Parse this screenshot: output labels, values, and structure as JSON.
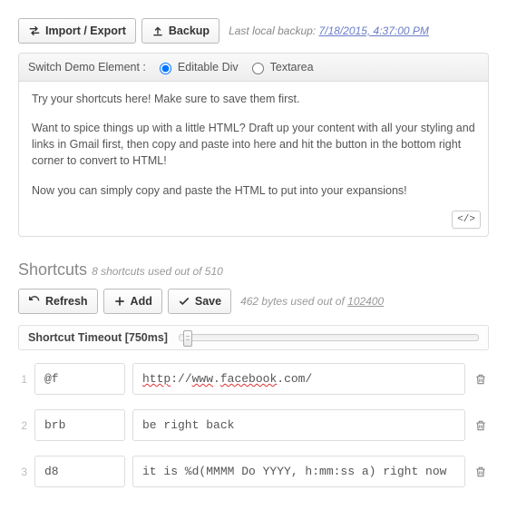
{
  "toolbar": {
    "import_export": "Import / Export",
    "backup": "Backup",
    "backup_prefix": "Last local backup:",
    "backup_time": "7/18/2015, 4:37:00 PM"
  },
  "demo": {
    "switch_label": "Switch Demo Element :",
    "opt_editable": "Editable Div",
    "opt_textarea": "Textarea",
    "p1": "Try your shortcuts here! Make sure to save them first.",
    "p2": "Want to spice things up with a little HTML? Draft up your content with all your styling and links in Gmail first, then copy and paste into here and hit the button in the bottom right corner to convert to HTML!",
    "p3": "Now you can simply copy and paste the HTML to put into your expansions!",
    "html_btn": "</>"
  },
  "shortcuts": {
    "title": "Shortcuts",
    "count_used": 8,
    "count_total": 510,
    "subtitle_template": "8 shortcuts used out of 510",
    "refresh": "Refresh",
    "add": "Add",
    "save": "Save",
    "bytes_used": 462,
    "bytes_total": 102400,
    "usage_template": "462 bytes used out of ",
    "timeout_label": "Shortcut Timeout [750ms]",
    "timeout_ms": 750,
    "rows": [
      {
        "n": "1",
        "key": "@f",
        "val": "http://www.facebook.com/"
      },
      {
        "n": "2",
        "key": "brb",
        "val": "be right back"
      },
      {
        "n": "3",
        "key": "d8",
        "val": "it is %d(MMMM Do YYYY, h:mm:ss a) right now"
      }
    ]
  }
}
